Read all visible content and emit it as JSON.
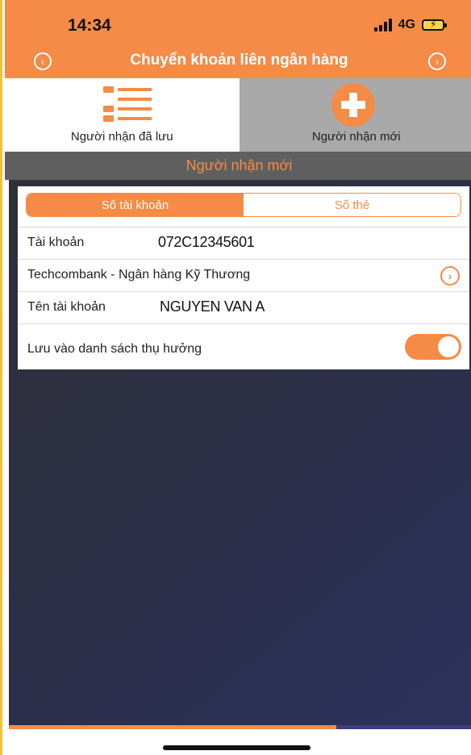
{
  "status_bar": {
    "time": "14:34",
    "network": "4G",
    "signal_icon": "signal-bars-icon",
    "battery_icon": "battery-charging-icon",
    "battery_fill_color": "#f7d547"
  },
  "header": {
    "title": "Chuyển khoản liên ngân hàng",
    "back_icon": "chevron-left-circle-icon",
    "next_icon": "chevron-right-circle-icon",
    "background_color": "#f58b46"
  },
  "tabs": [
    {
      "label": "Người nhận đã lưu",
      "icon": "list-icon",
      "active": true
    },
    {
      "label": "Người nhận mới",
      "icon": "plus-circle-icon",
      "active": false
    }
  ],
  "section": {
    "title": "Người nhận mới"
  },
  "segment": {
    "options": [
      "Số tài khoản",
      "Số thẻ"
    ],
    "selected": "Số tài khoản"
  },
  "form": {
    "account_label": "Tài khoản",
    "account_value": "072C12345601",
    "bank_value": "Techcombank - Ngân hàng Kỹ Thương",
    "bank_icon": "chevron-right-circle-icon",
    "name_label": "Tên tài khoản",
    "name_value": "NGUYEN VAN A",
    "save_label": "Lưu vào danh sách thụ hưởng",
    "save_toggle_on": true
  },
  "colors": {
    "accent": "#f58b46",
    "section_bar": "#5f5f5f",
    "inactive_tab": "#a9a9a9",
    "main_background": "#2c2f49"
  }
}
